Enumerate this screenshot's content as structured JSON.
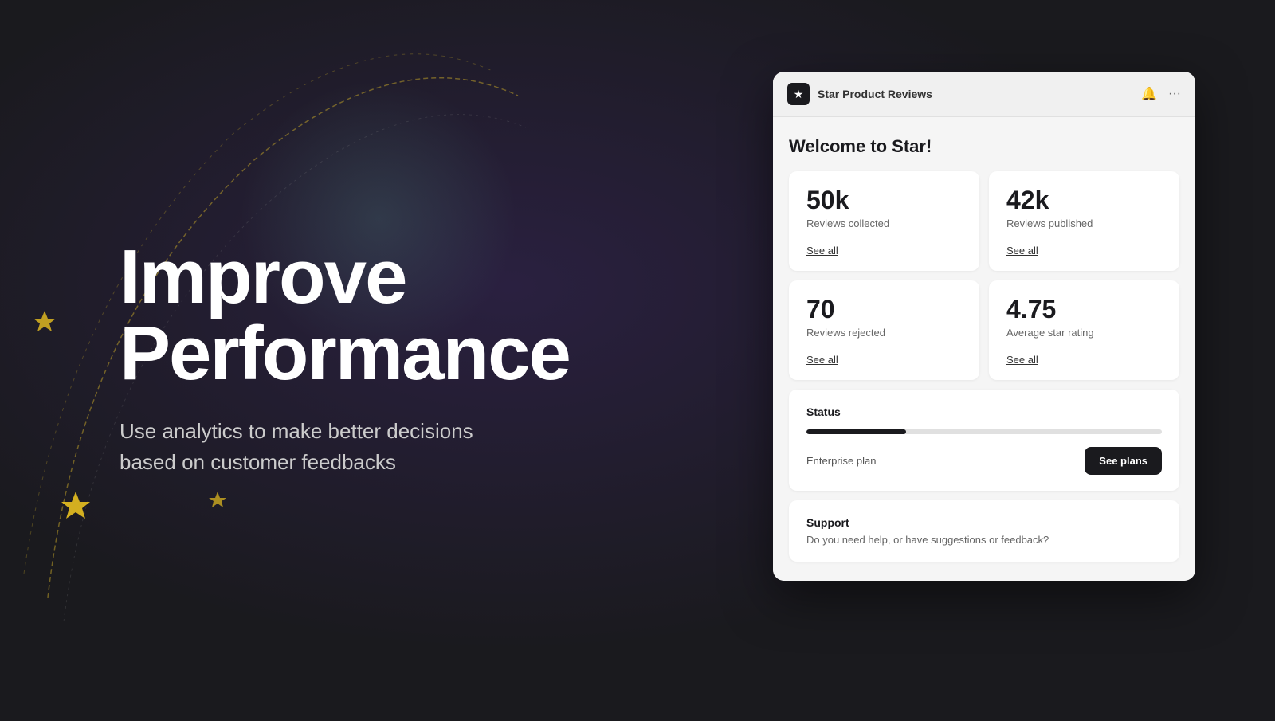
{
  "background": {
    "color": "#1a1a1e"
  },
  "left": {
    "heading_line1": "Improve",
    "heading_line2": "Performance",
    "subheading": "Use analytics to make better decisions based on customer feedbacks"
  },
  "app_window": {
    "title_bar": {
      "app_name": "Star Product Reviews",
      "bell_icon": "🔔",
      "more_icon": "···"
    },
    "welcome": "Welcome to Star!",
    "stats": [
      {
        "value": "50k",
        "label": "Reviews collected",
        "link": "See all"
      },
      {
        "value": "42k",
        "label": "Reviews published",
        "link": "See all"
      },
      {
        "value": "70",
        "label": "Reviews rejected",
        "link": "See all"
      },
      {
        "value": "4.75",
        "label": "Average star rating",
        "link": "See all"
      }
    ],
    "status": {
      "title": "Status",
      "plan": "Enterprise plan",
      "progress_percent": 28,
      "see_plans_label": "See plans"
    },
    "support": {
      "title": "Support",
      "text": "Do you need help, or have suggestions or feedback?"
    }
  }
}
